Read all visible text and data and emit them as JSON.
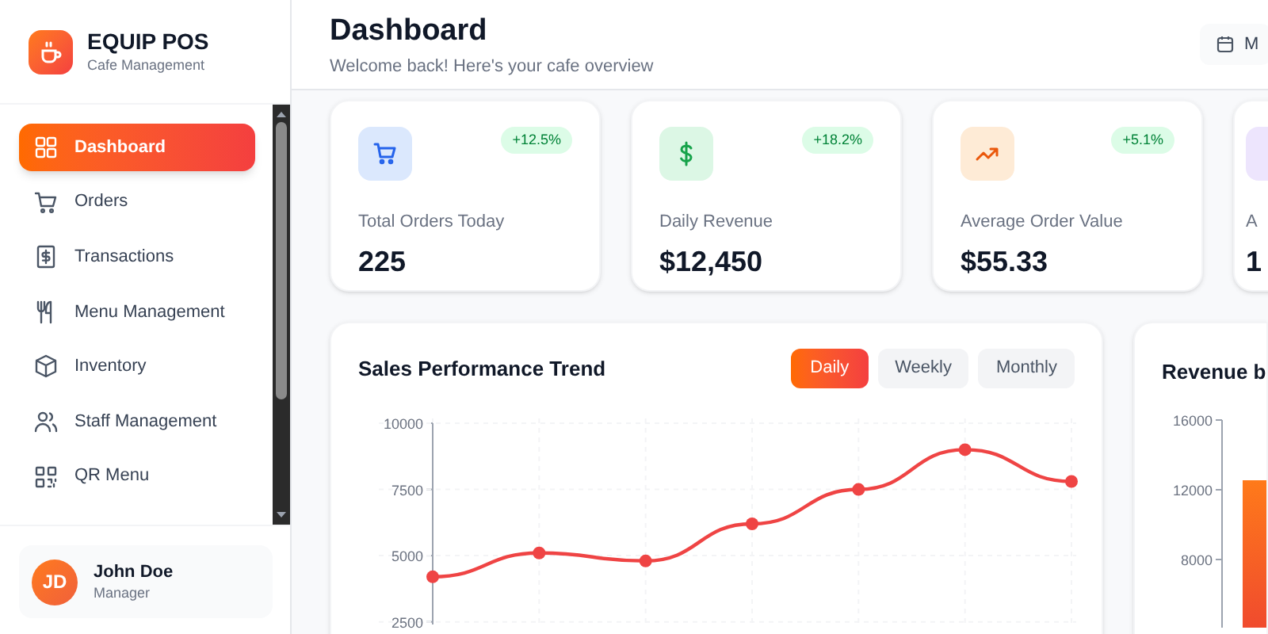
{
  "brand": {
    "name": "EQUIP POS",
    "subtitle": "Cafe Management"
  },
  "nav": [
    {
      "label": "Dashboard",
      "kind": "grid",
      "selected": true
    },
    {
      "label": "Orders",
      "kind": "cart",
      "selected": false
    },
    {
      "label": "Transactions",
      "kind": "receipt",
      "selected": false
    },
    {
      "label": "Menu Management",
      "kind": "utensils",
      "selected": false
    },
    {
      "label": "Inventory",
      "kind": "box",
      "selected": false
    },
    {
      "label": "Staff Management",
      "kind": "people",
      "selected": false
    },
    {
      "label": "QR Menu",
      "kind": "qr",
      "selected": false
    }
  ],
  "user": {
    "initials": "JD",
    "name": "John Doe",
    "role": "Manager"
  },
  "header": {
    "title": "Dashboard",
    "subtitle": "Welcome back! Here's your cafe overview",
    "date_button": "M"
  },
  "stats": [
    {
      "kind": "cart",
      "label": "Total Orders Today",
      "value": "225",
      "change": "+12.5%"
    },
    {
      "kind": "dollar",
      "label": "Daily Revenue",
      "value": "$12,450",
      "change": "+18.2%"
    },
    {
      "kind": "trend",
      "label": "Average Order Value",
      "value": "$55.33",
      "change": "+5.1%"
    },
    {
      "kind": "blank",
      "label": "A",
      "value": "1"
    }
  ],
  "sales_card": {
    "title": "Sales Performance Trend",
    "periods": [
      {
        "label": "Daily",
        "selected": true
      },
      {
        "label": "Weekly",
        "selected": false
      },
      {
        "label": "Monthly",
        "selected": false
      }
    ],
    "chart_data": {
      "type": "line",
      "ylim": [
        2400,
        10000
      ],
      "yticks": [
        2500,
        5000,
        7500,
        10000
      ],
      "grid": true,
      "series": [
        {
          "color": "#ef4444",
          "marker": "circle",
          "values": [
            4200,
            5100,
            4800,
            6200,
            7500,
            9000,
            7800
          ]
        }
      ]
    }
  },
  "revenue_card": {
    "title": "Revenue b",
    "y_axis_labels": [
      "16000",
      "12000",
      "8000"
    ]
  }
}
